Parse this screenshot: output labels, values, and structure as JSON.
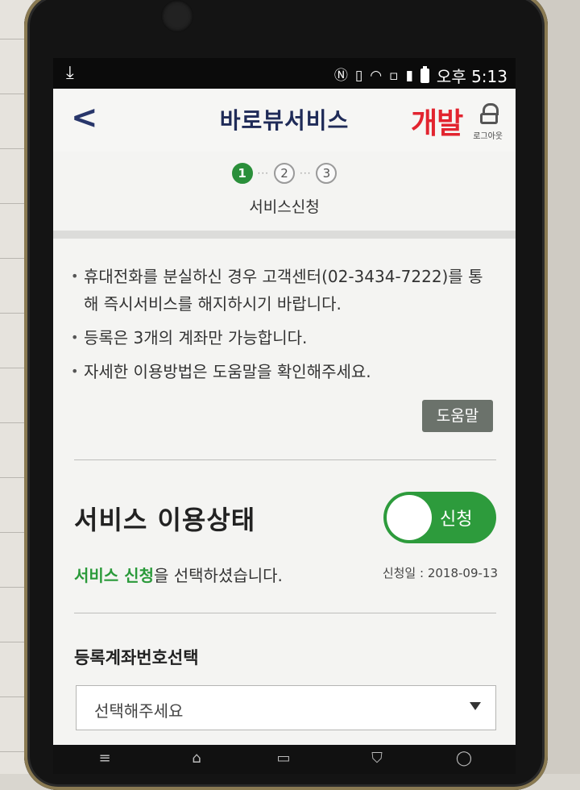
{
  "status_bar": {
    "left_icon": "download-icon",
    "right_icons": [
      "nfc-icon",
      "vibrate-icon",
      "wifi-icon",
      "sim-icon",
      "signal-icon",
      "battery-icon"
    ],
    "clock": "오후 5:13"
  },
  "header": {
    "title": "바로뷰서비스",
    "badge": "개발",
    "logout_label": "로그아웃"
  },
  "steps": {
    "items": [
      "1",
      "2",
      "3"
    ],
    "active_index": 0,
    "label": "서비스신청",
    "active_color": "#2a8f3a"
  },
  "notices": [
    "휴대전화를 분실하신 경우 고객센터(02-3434-7222)를 통해 즉시서비스를 해지하시기 바랍니다.",
    "등록은 3개의 계좌만 가능합니다.",
    "자세한 이용방법은 도움말을 확인해주세요."
  ],
  "help_button": "도움말",
  "service_status": {
    "title": "서비스 이용상태",
    "toggle_label": "신청",
    "toggle_on": true,
    "message_highlight": "서비스 신청",
    "message_rest": "을 선택하셨습니다.",
    "apply_date": "신청일 : 2018-09-13",
    "accent_color": "#2d9b3c"
  },
  "account_select": {
    "label": "등록계좌번호선택",
    "value": "선택해주세요"
  },
  "nav_bar": {
    "icons": [
      "menu-icon",
      "home-icon",
      "recent-apps-icon",
      "shield-icon",
      "back-icon"
    ]
  },
  "colors": {
    "title": "#1f2b58",
    "badge": "#e2242f",
    "help_button": "#6b726b"
  }
}
